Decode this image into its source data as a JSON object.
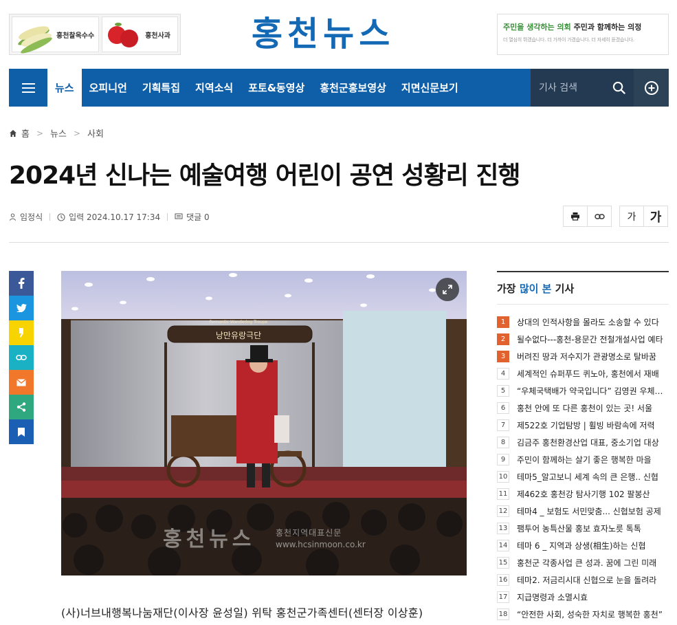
{
  "header": {
    "left_ad": {
      "item1": "홍천찰옥수수",
      "item2": "홍천사과"
    },
    "logo": "홍천뉴스",
    "right_ad": {
      "green": "주민을 생각하는 의회",
      "black": "주민과 함께하는 의정",
      "sub": "더 열심히 뛰겠습니다. 더 가까이 가겠습니다. 더 자세히 듣겠습니다."
    }
  },
  "nav": {
    "items": [
      "뉴스",
      "오피니언",
      "기획특집",
      "지역소식",
      "포토&동영상",
      "홍천군홍보영상",
      "지면신문보기"
    ],
    "search_placeholder": "기사 검색"
  },
  "breadcrumb": [
    "홈",
    "뉴스",
    "사회"
  ],
  "article": {
    "title": "2024년 신나는 예술여행 어린이 공연 성황리 진행",
    "author": "임정식",
    "date": "입력 2024.10.17 17:34",
    "comments": "댓글 0",
    "font_small": "가",
    "font_large": "가",
    "photo_sign_top": "Romantic Wandering Troupe",
    "photo_sign": "낭만유랑극단",
    "watermark": "홍천뉴스",
    "watermark_sub1": "홍천지역대표신문",
    "watermark_sub2": "www.hcsinmoon.co.kr",
    "body_first_line": "(사)너브내행복나눔재단(이사장 윤성일) 위탁 홍천군가족센터(센터장 이상훈)"
  },
  "popular": {
    "title_prefix": "가장 ",
    "title_highlight": "많이 본",
    "title_suffix": " 기사",
    "items": [
      {
        "rank": "1",
        "title": "상대의 인적사항을 몰라도 소송할 수 있다"
      },
      {
        "rank": "2",
        "title": "될수없다---홍천-용문간 전철개설사업 예타"
      },
      {
        "rank": "3",
        "title": "버려진 땅과 저수지가 관광명소로 탈바꿈"
      },
      {
        "rank": "4",
        "title": "세계적인 슈퍼푸드 퀴노아, 홍천에서 재배"
      },
      {
        "rank": "5",
        "title": "“우체국택배가 약국입니다” 김영권 우체국장"
      },
      {
        "rank": "6",
        "title": "홍천 안에 또 다른 홍천이 있는 곳! 서울"
      },
      {
        "rank": "7",
        "title": "제522호 기업탐방 | 휠빙 바람속에 저력"
      },
      {
        "rank": "8",
        "title": "김금주 홍천환경산업 대표, 중소기업 대상"
      },
      {
        "rank": "9",
        "title": "주민이 함께하는 살기 좋은 행복한 마을"
      },
      {
        "rank": "10",
        "title": "테마5_알고보니 세계 속의 큰 은행.. 신협"
      },
      {
        "rank": "11",
        "title": "제462호 홍천강 탐사기행 102 팔봉산"
      },
      {
        "rank": "12",
        "title": "테마4 _ 보험도 서민맞춤... 신협보험 공제"
      },
      {
        "rank": "13",
        "title": "팸투어 농특산물 홍보 효자노릇 톡톡"
      },
      {
        "rank": "14",
        "title": "테마 6 _ 지역과 상생(相生)하는 신협"
      },
      {
        "rank": "15",
        "title": "홍천군 각종사업 큰 성과. 꿈에 그린 미래"
      },
      {
        "rank": "16",
        "title": "테마2. 저금리시대 신협으로 눈을 돌려라"
      },
      {
        "rank": "17",
        "title": "지급명령과 소멸시효"
      },
      {
        "rank": "18",
        "title": "“안전한 사회, 성숙한 자치로 행복한 홍천”"
      }
    ]
  },
  "colors": {
    "brand": "#0f5fa8",
    "rank_hot": "#e2622f",
    "facebook": "#3b5998",
    "twitter": "#1b95e0",
    "kakao": "#f7d300",
    "link": "#1bb1c4",
    "mail": "#f1782a",
    "share": "#2fa87f",
    "bookmark": "#1a5fb4"
  }
}
